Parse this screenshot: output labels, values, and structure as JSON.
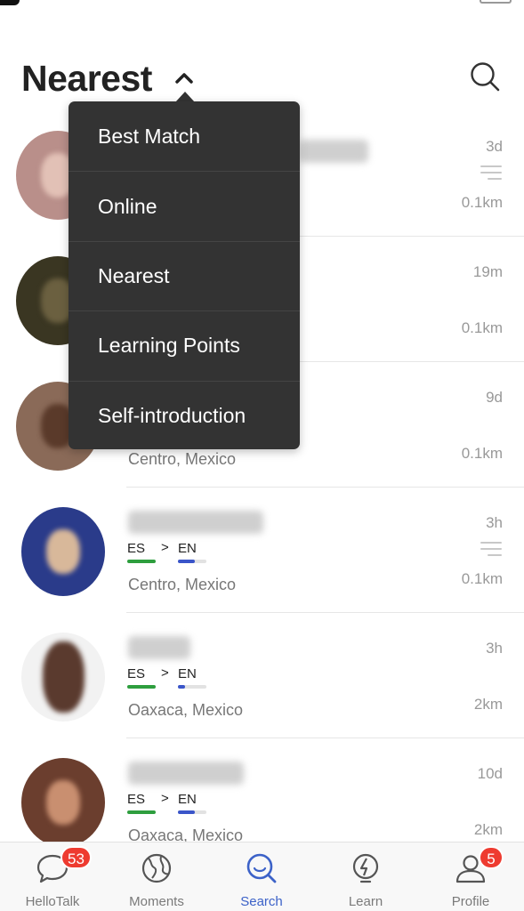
{
  "header": {
    "sort_title": "Nearest"
  },
  "sort_menu": {
    "options": [
      "Best Match",
      "Online",
      "Nearest",
      "Learning Points",
      "Self-introduction"
    ]
  },
  "users": [
    {
      "location": "",
      "time": "3d",
      "distance": "0.1km",
      "native": "",
      "learning": ""
    },
    {
      "location": "",
      "time": "19m",
      "distance": "0.1km",
      "native": "",
      "learning": ""
    },
    {
      "location": "Centro, Mexico",
      "time": "9d",
      "distance": "0.1km",
      "native": "",
      "learning": ""
    },
    {
      "location": "Centro, Mexico",
      "time": "3h",
      "distance": "0.1km",
      "native": "ES",
      "learning": "EN"
    },
    {
      "location": "Oaxaca, Mexico",
      "time": "3h",
      "distance": "2km",
      "native": "ES",
      "learning": "EN"
    },
    {
      "location": "Oaxaca, Mexico",
      "time": "10d",
      "distance": "2km",
      "native": "ES",
      "learning": "EN"
    }
  ],
  "language_arrow": ">",
  "tabs": [
    {
      "label": "HelloTalk",
      "badge": "53",
      "icon": "chat-bubble-icon"
    },
    {
      "label": "Moments",
      "badge": "",
      "icon": "globe-icon"
    },
    {
      "label": "Search",
      "badge": "",
      "icon": "search-icon"
    },
    {
      "label": "Learn",
      "badge": "",
      "icon": "lightning-bulb-icon"
    },
    {
      "label": "Profile",
      "badge": "5",
      "icon": "person-icon"
    }
  ],
  "colors": {
    "accent": "#3c62c8",
    "badge": "#ee3b30",
    "native_bar": "#2e9e3e",
    "learning_bar": "#3a55c9",
    "menu_bg": "#333333"
  }
}
